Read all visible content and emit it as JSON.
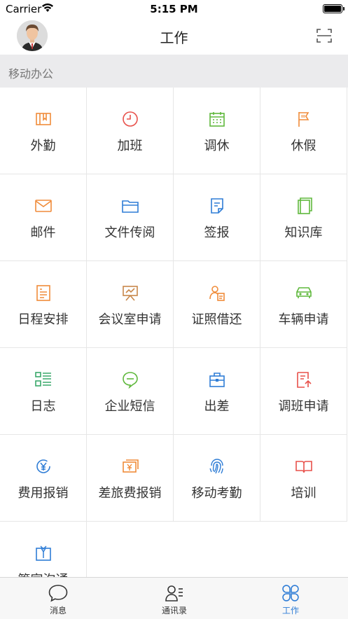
{
  "status_bar": {
    "carrier": "Carrier",
    "time": "5:15 PM"
  },
  "nav": {
    "title": "工作"
  },
  "section": {
    "title": "移动办公"
  },
  "items": [
    {
      "label": "外勤",
      "icon": "map-icon",
      "color": "#f08c3a"
    },
    {
      "label": "加班",
      "icon": "clock-icon",
      "color": "#e8504a"
    },
    {
      "label": "调休",
      "icon": "calendar-icon",
      "color": "#5fb83c"
    },
    {
      "label": "休假",
      "icon": "flag-icon",
      "color": "#f08c3a"
    },
    {
      "label": "邮件",
      "icon": "mail-icon",
      "color": "#f08c3a"
    },
    {
      "label": "文件传阅",
      "icon": "folder-icon",
      "color": "#2f7dd6"
    },
    {
      "label": "签报",
      "icon": "document-icon",
      "color": "#2f7dd6"
    },
    {
      "label": "知识库",
      "icon": "book-icon",
      "color": "#5fb83c"
    },
    {
      "label": "日程安排",
      "icon": "schedule-icon",
      "color": "#f08c3a"
    },
    {
      "label": "会议室申请",
      "icon": "meeting-board-icon",
      "color": "#c8874a"
    },
    {
      "label": "证照借还",
      "icon": "id-card-icon",
      "color": "#f08c3a"
    },
    {
      "label": "车辆申请",
      "icon": "car-icon",
      "color": "#5fb83c"
    },
    {
      "label": "日志",
      "icon": "list-icon",
      "color": "#3aa86b"
    },
    {
      "label": "企业短信",
      "icon": "chat-bubble-icon",
      "color": "#5fb83c"
    },
    {
      "label": "出差",
      "icon": "briefcase-icon",
      "color": "#2f7dd6"
    },
    {
      "label": "调班申请",
      "icon": "shift-swap-icon",
      "color": "#e8504a"
    },
    {
      "label": "费用报销",
      "icon": "yen-refund-icon",
      "color": "#2f7dd6"
    },
    {
      "label": "差旅费报销",
      "icon": "yen-bill-icon",
      "color": "#f08c3a"
    },
    {
      "label": "移动考勤",
      "icon": "fingerprint-icon",
      "color": "#2f7dd6"
    },
    {
      "label": "培训",
      "icon": "open-book-icon",
      "color": "#e8504a"
    },
    {
      "label": "管家沟通",
      "icon": "butler-icon",
      "color": "#2f7dd6"
    }
  ],
  "tabs": [
    {
      "label": "消息",
      "icon": "chat-icon",
      "active": false
    },
    {
      "label": "通讯录",
      "icon": "contacts-icon",
      "active": false
    },
    {
      "label": "工作",
      "icon": "clover-grid-icon",
      "active": true
    }
  ],
  "accent_color": "#2f7dd6"
}
